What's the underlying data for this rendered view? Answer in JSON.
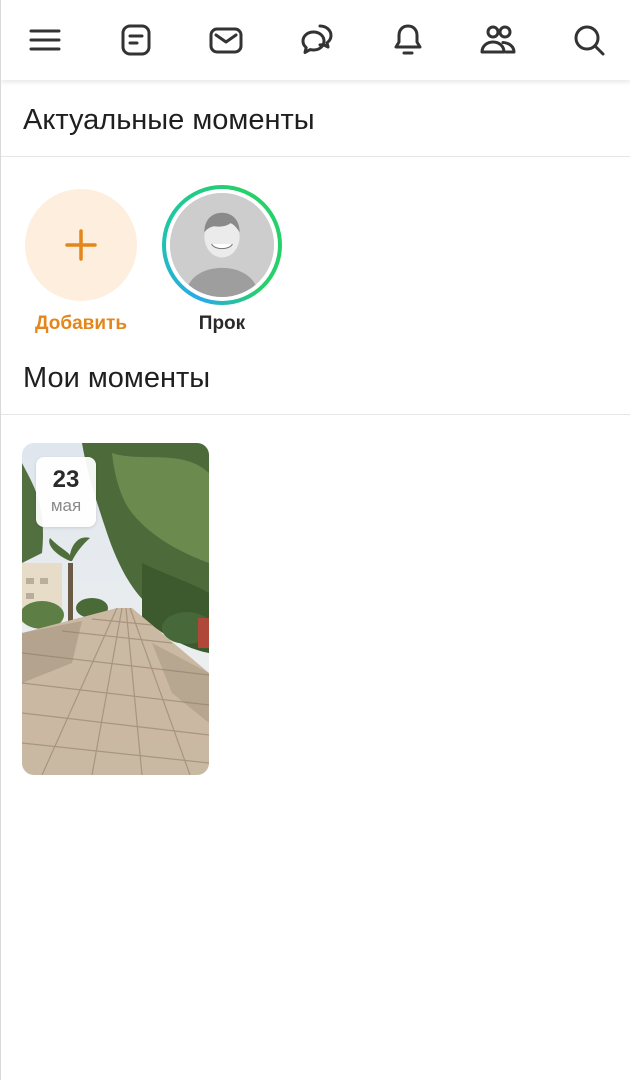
{
  "toolbar": {
    "icons": [
      "menu-icon",
      "feed-icon",
      "mail-icon",
      "chat-icon",
      "bell-icon",
      "friends-icon",
      "search-icon"
    ]
  },
  "sections": {
    "actual_title": "Актуальные моменты",
    "mine_title": "Мои моменты"
  },
  "moments": {
    "add_label": "Добавить",
    "user_name": "Прок"
  },
  "my_moments": [
    {
      "day": "23",
      "month": "мая"
    }
  ],
  "colors": {
    "accent": "#e3861b",
    "add_bg": "#fdeedd",
    "ring_green": "#26d06a",
    "ring_blue": "#2aa9e8",
    "icon": "#333333"
  }
}
